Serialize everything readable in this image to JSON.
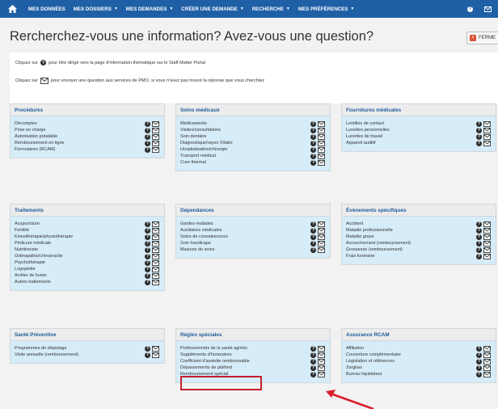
{
  "nav": {
    "items": [
      {
        "label": "MES DONNÉES",
        "caret": false
      },
      {
        "label": "MES DOSSIERS",
        "caret": true
      },
      {
        "label": "MES DEMANDES",
        "caret": true
      },
      {
        "label": "CRÉER UNE DEMANDE",
        "caret": true
      },
      {
        "label": "RECHERCHE",
        "caret": true
      },
      {
        "label": "MES PRÉFÉRENCES",
        "caret": true
      }
    ]
  },
  "page_title": "Rercherchez-vous une information? Avez-vous une question?",
  "close_label": "FERME",
  "info": {
    "line1_before": "Cliquez sur",
    "line1_after": "pour être dirigé vers la page d'information thématique sur le Staff Matter Portal",
    "line2_before": "Cliquez sur",
    "line2_after": "pour envoyer une question aux services de PMO, si vous n'avez pas trouvé la réponse que vous cherchiez"
  },
  "panels": [
    {
      "title": "Procédures",
      "items": [
        "Décomptes",
        "Prise en charge",
        "Autorisation préalable",
        "Remboursement en ligne",
        "Formulaires (RCAM)"
      ]
    },
    {
      "title": "Soins médicaux",
      "items": [
        "Médicaments",
        "Visites/consultations",
        "Soin dentaire",
        "Diagnostique/rayon X/labo",
        "Hospitalisation/chirurgie",
        "Transport médical",
        "Cure thermal"
      ]
    },
    {
      "title": "Fournitures médicales",
      "items": [
        "Lentilles de contact",
        "Lunettes personnelles",
        "Lunettes de travail",
        "Appareil auditif"
      ]
    },
    {
      "title": "Traitements",
      "items": [
        "Acupuncture",
        "Fertilité",
        "Kinesithérapie/physiothérapie",
        "Pédicure médicale",
        "Nutritioniste",
        "Ostéopathie/chiropractie",
        "Psychothérapie",
        "Logopédie",
        "Arrêter de fumer",
        "Autres traitements"
      ]
    },
    {
      "title": "Dépendances",
      "items": [
        "Gardes-malades",
        "Auxiliaires médicales",
        "Soins de convalescence",
        "Soin handicape",
        "Maisons de soins"
      ]
    },
    {
      "title": "Évènements spécifiques",
      "items": [
        "Accident",
        "Maladie professionnelle",
        "Maladie grave",
        "Accouchement (remboursement)",
        "Grossesse (remboursement)",
        "Frais funéraire"
      ]
    },
    {
      "title": "Santé Préventive",
      "items": [
        "Programmes de dépistage",
        "Visite annuelle (remboursement)"
      ]
    },
    {
      "title": "Règles spéciales",
      "items": [
        "Professionnels de la santé agréés",
        "Suppléments d'honoraires",
        "Coefficient d'assiette remboursable",
        "Dépassements de plafond",
        "Remboursement spécial"
      ]
    },
    {
      "title": "Assurance RCAM",
      "items": [
        "Affiliation",
        "Couverture complémentaire",
        "Législation et références",
        "Zorgkas",
        "Bureau liquidateur"
      ]
    }
  ],
  "colors": {
    "navbar": "#1f5fa6",
    "panel_body": "#d6ecf8",
    "panel_title": "#1c5a99",
    "highlight": "#c4202e"
  },
  "icons": {
    "help": "question-circle-icon",
    "mail": "envelope-icon",
    "home": "home-icon",
    "user": "user-icon"
  }
}
